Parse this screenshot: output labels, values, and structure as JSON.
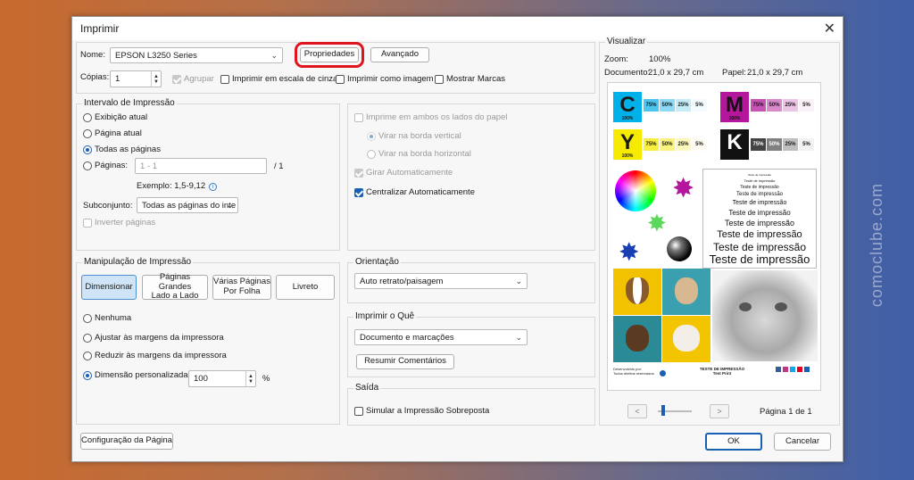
{
  "watermark": "comoclube.com",
  "dialog": {
    "title": "Imprimir",
    "close": "✕"
  },
  "printer": {
    "name_label": "Nome:",
    "name_value": "EPSON L3250 Series",
    "properties_button": "Propriedades",
    "advanced_button": "Avançado",
    "copies_label": "Cópias:",
    "copies_value": "1",
    "collate_label": "Agrupar",
    "grayscale_label": "Imprimir em escala de cinza",
    "as_image_label": "Imprimir como imagem",
    "show_marks_label": "Mostrar Marcas"
  },
  "range": {
    "legend": "Intervalo de Impressão",
    "current_view": "Exibição atual",
    "current_page": "Página atual",
    "all_pages": "Todas as páginas",
    "pages_label": "Páginas:",
    "pages_value": "1 - 1",
    "pages_total": "/ 1",
    "example": "Exemplo: 1,5-9,12",
    "subset_label": "Subconjunto:",
    "subset_value": "Todas as páginas do inte",
    "reverse_pages": "Inverter páginas"
  },
  "options": {
    "both_sides": "Imprime em ambos os lados do papel",
    "flip_long": "Virar na borda vertical",
    "flip_short": "Virar na borda horizontal",
    "auto_rotate": "Girar Automaticamente",
    "auto_center": "Centralizar Automaticamente"
  },
  "handling": {
    "legend": "Manipulação de Impressão",
    "btn_size": "Dimensionar",
    "btn_poster_1": "Páginas Grandes",
    "btn_poster_2": "Lado a Lado",
    "btn_multiple_1": "Várias Páginas",
    "btn_multiple_2": "Por Folha",
    "btn_booklet": "Livreto",
    "none": "Nenhuma",
    "fit": "Ajustar às margens da impressora",
    "shrink": "Reduzir às margens da impressora",
    "custom": "Dimensão personalizada",
    "custom_value": "100",
    "percent": "%"
  },
  "orientation": {
    "legend": "Orientação",
    "value": "Auto retrato/paisagem"
  },
  "what": {
    "legend": "Imprimir o Quê",
    "value": "Documento e marcações",
    "summarize_button": "Resumir Comentários"
  },
  "output": {
    "legend": "Saída",
    "simulate": "Simular a Impressão Sobreposta"
  },
  "page_setup_button": "Configuração da Página",
  "preview": {
    "legend": "Visualizar",
    "zoom_label": "Zoom:",
    "zoom_value": "100%",
    "doc_label": "Documento:",
    "doc_value": "21,0 x 29,7 cm",
    "paper_label": "Papel:",
    "paper_value": "21,0 x 29,7 cm",
    "page_indicator": "Página 1 de 1",
    "prev": "<",
    "next": ">"
  },
  "test_page": {
    "letters": [
      "C",
      "M",
      "Y",
      "K"
    ],
    "hundred": "100%",
    "shades": [
      "75%",
      "50%",
      "25%",
      "5%"
    ],
    "colors": {
      "cyan": "#00b0e8",
      "magenta": "#b4169c",
      "yellow": "#f5ea00",
      "black": "#111111"
    },
    "small_heading": "Teste de impressão",
    "test_lines": [
      "Teste de impressão",
      "Teste de impressão",
      "Teste de impressão",
      "Teste de impressão",
      "Teste de impressão",
      "Teste de impressão",
      "Teste de impressão",
      "Teste de impressão",
      "Teste de impressão"
    ],
    "footer_left_1": "Desenvolvido por:",
    "footer_left_2": "Todos direitos reservados.",
    "footer_center_1": "TESTE DE IMPRESSÃO",
    "footer_center_2": "Test Print"
  },
  "buttons": {
    "ok": "OK",
    "cancel": "Cancelar"
  }
}
